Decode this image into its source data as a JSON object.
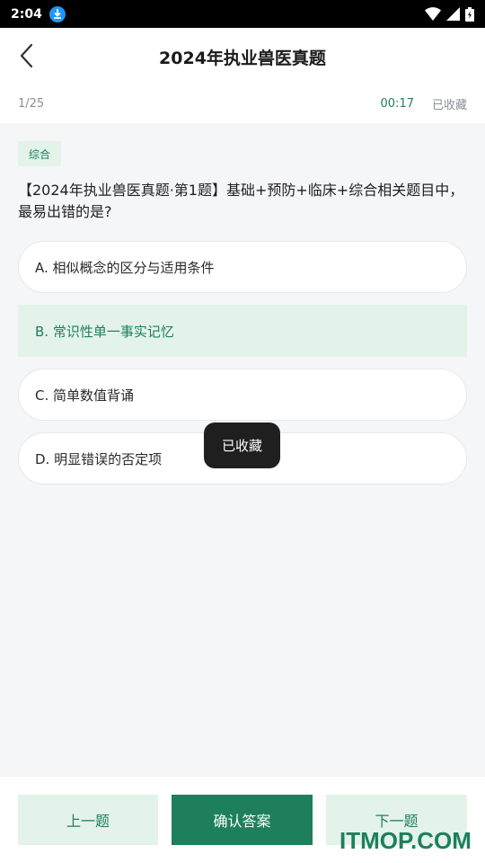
{
  "status_bar": {
    "time": "2:04",
    "icons": [
      "download-icon",
      "wifi-icon",
      "signal-icon",
      "battery-icon"
    ]
  },
  "header": {
    "title": "2024年执业兽医真题"
  },
  "info_bar": {
    "progress": "1/25",
    "timer": "00:17",
    "favorite_status": "已收藏"
  },
  "question": {
    "tag": "综合",
    "text": "【2024年执业兽医真题·第1题】基础+预防+临床+综合相关题目中，最易出错的是?",
    "options": [
      {
        "label": "A. 相似概念的区分与适用条件",
        "selected": false
      },
      {
        "label": "B. 常识性单一事实记忆",
        "selected": true
      },
      {
        "label": "C. 简单数值背诵",
        "selected": false
      },
      {
        "label": "D. 明显错误的否定项",
        "selected": false
      }
    ]
  },
  "toast": {
    "text": "已收藏"
  },
  "footer": {
    "prev_label": "上一题",
    "confirm_label": "确认答案",
    "next_label": "下一题"
  },
  "watermark": {
    "text": "ITMOP.COM"
  },
  "colors": {
    "accent": "#1e7f5c",
    "accent_light": "#e3f3ea",
    "background": "#f5f6f8"
  }
}
